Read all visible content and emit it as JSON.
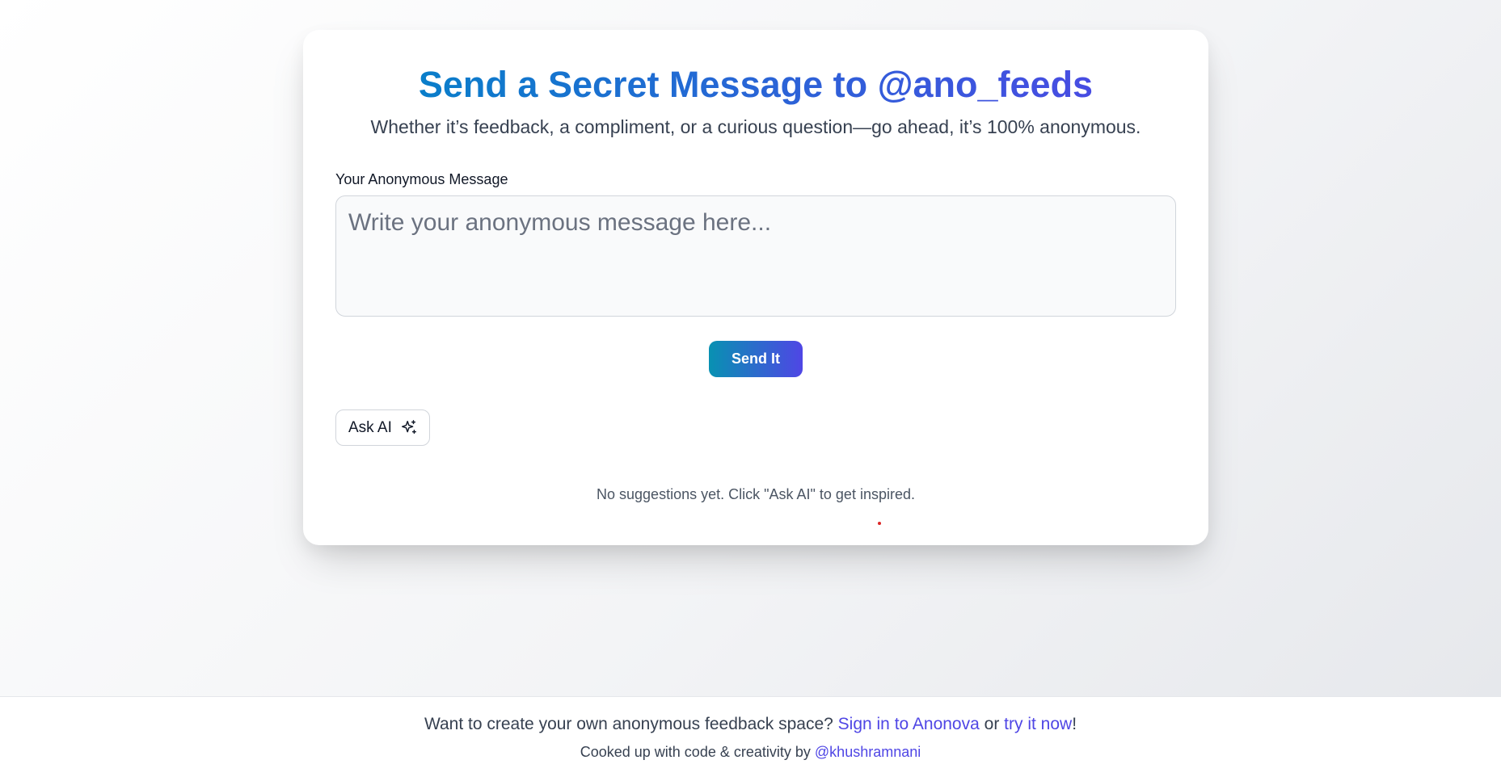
{
  "card": {
    "title": "Send a Secret Message to @ano_feeds",
    "subtitle": "Whether it’s feedback, a compliment, or a curious question—go ahead, it’s 100% anonymous.",
    "field_label": "Your Anonymous Message",
    "message_value": "",
    "message_placeholder": "Write your anonymous message here...",
    "send_label": "Send It",
    "ask_ai_label": "Ask AI",
    "ask_ai_icon": "sparkles-icon",
    "empty_state": "No suggestions yet. Click \"Ask AI\" to get inspired."
  },
  "footer": {
    "prompt": "Want to create your own anonymous feedback space?",
    "signin_link": "Sign in to Anonova",
    "or_text": "or",
    "try_link": "try it now",
    "exclamation": "!",
    "credit_text": "Cooked up with code & creativity by",
    "credit_link": "@khushramnani"
  },
  "colors": {
    "gradient_start": "#0284c7",
    "gradient_end": "#4f46e5",
    "link": "#4f46e5"
  }
}
